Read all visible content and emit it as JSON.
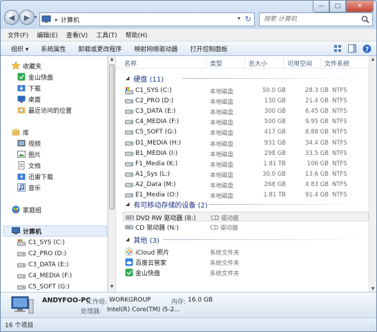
{
  "window": {
    "minimize": "—",
    "maximize": "□",
    "close": "✕"
  },
  "nav": {
    "back": "◀",
    "forward": "▶",
    "dropdown": "▾"
  },
  "address": {
    "separator": "▸",
    "path": "计算机",
    "dropdown": "▾",
    "refresh": "↻"
  },
  "search": {
    "placeholder": "搜索 计算机"
  },
  "menubar": [
    "文件(F)",
    "编辑(E)",
    "查看(V)",
    "工具(T)",
    "帮助(H)"
  ],
  "toolbar": {
    "items": [
      "组织 ▾",
      "系统属性",
      "卸载或更改程序",
      "映射网络驱动器",
      "打开控制面板"
    ]
  },
  "sidebar": {
    "favorites_title": "收藏夹",
    "favorites": [
      "金山快盘",
      "下载",
      "桌面",
      "最近访问的位置"
    ],
    "libraries_title": "库",
    "libraries": [
      "视频",
      "图片",
      "文档",
      "迅雷下载",
      "音乐"
    ],
    "homegroup": "家庭组",
    "computer_title": "计算机",
    "computer_items": [
      "C1_SYS (C:)",
      "C2_PRO (D:)",
      "C3_DATA (E:)",
      "C4_MEDIA (F:)",
      "C5_SOFT (G:)"
    ]
  },
  "columns": [
    "名称",
    "类型",
    "总大小",
    "可用空间",
    "文件系统"
  ],
  "groups": {
    "disks_title": "硬盘 (11)",
    "removable_title": "有可移动存储的设备 (2)",
    "other_title": "其他 (3)"
  },
  "disks": [
    {
      "name": "C1_SYS (C:)",
      "type": "本地磁盘",
      "total": "50.0 GB",
      "free": "28.3 GB",
      "fs": "NTFS"
    },
    {
      "name": "C2_PRO (D:)",
      "type": "本地磁盘",
      "total": "130 GB",
      "free": "21.4 GB",
      "fs": "NTFS"
    },
    {
      "name": "C3_DATA (E:)",
      "type": "本地磁盘",
      "total": "300 GB",
      "free": "6.45 GB",
      "fs": "NTFS"
    },
    {
      "name": "C4_MEDIA (F:)",
      "type": "本地磁盘",
      "total": "500 GB",
      "free": "9.95 GB",
      "fs": "NTFS"
    },
    {
      "name": "C5_SOFT (G:)",
      "type": "本地磁盘",
      "total": "417 GB",
      "free": "8.88 GB",
      "fs": "NTFS"
    },
    {
      "name": "D1_MEDIA (H:)",
      "type": "本地磁盘",
      "total": "931 GB",
      "free": "34.4 GB",
      "fs": "NTFS"
    },
    {
      "name": "B1_MEDIA (I:)",
      "type": "本地磁盘",
      "total": "298 GB",
      "free": "33.5 GB",
      "fs": "NTFS"
    },
    {
      "name": "F1_Media (K:)",
      "type": "本地磁盘",
      "total": "1.81 TB",
      "free": "106 GB",
      "fs": "NTFS"
    },
    {
      "name": "A1_Sys (L:)",
      "type": "本地磁盘",
      "total": "30.0 GB",
      "free": "13.6 GB",
      "fs": "NTFS"
    },
    {
      "name": "A2_Data (M:)",
      "type": "本地磁盘",
      "total": "268 GB",
      "free": "4.83 GB",
      "fs": "NTFS"
    },
    {
      "name": "E1_Media (O:)",
      "type": "本地磁盘",
      "total": "1.81 TB",
      "free": "91.4 GB",
      "fs": "NTFS"
    }
  ],
  "removable": [
    {
      "name": "DVD RW 驱动器 (B:)",
      "type": "CD 驱动器"
    },
    {
      "name": "CD 驱动器 (N:)",
      "type": "CD 驱动器"
    }
  ],
  "other": [
    {
      "name": "iCloud 照片",
      "type": "系统文件夹"
    },
    {
      "name": "百度云管家",
      "type": "系统文件夹"
    },
    {
      "name": "金山快盘",
      "type": "系统文件夹"
    }
  ],
  "details": {
    "pc_name": "ANDYFOO-PC",
    "workgroup_label": "工作组:",
    "workgroup": "WORKGROUP",
    "memory_label": "内存:",
    "memory": "16.0 GB",
    "cpu_label": "处理器:",
    "cpu": "Intel(R) Core(TM) i5-2..."
  },
  "status": {
    "count": "16 个项目"
  },
  "colors": {
    "group_heading": "#1e3287",
    "selection": "#e5eefa",
    "close_button": "#c4452f"
  }
}
